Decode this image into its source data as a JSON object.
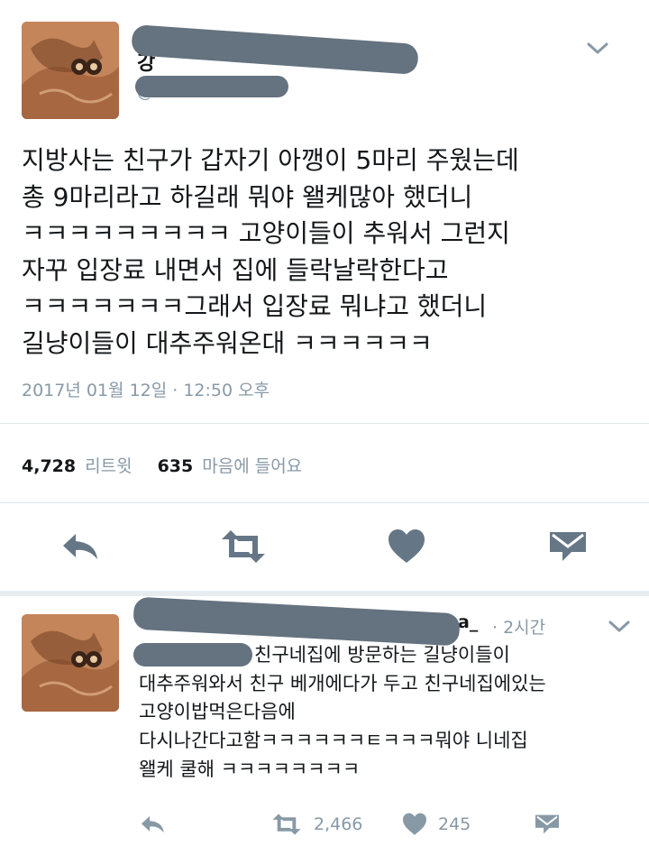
{
  "tweet": {
    "name_visible_head": "강",
    "name_visible_tail": "a",
    "handle_visible_head": "@",
    "text_lines": [
      "지방사는 친구가 갑자기 아깽이 5마리 주웠는데",
      "총 9마리라고 하길래 뭐야 왤케많아 했더니",
      "ㅋㅋㅋㅋㅋㅋㅋㅋㅋ 고양이들이 추워서 그런지",
      "자꾸 입장료 내면서 집에 들락날락한다고",
      "ㅋㅋㅋㅋㅋㅋㅋ그래서 입장료 뭐냐고 했더니",
      "길냥이들이 대추주워온대 ㅋㅋㅋㅋㅋㅋ"
    ],
    "timestamp": "2017년 01월 12일 · 12:50 오후",
    "retweet_count": "4,728",
    "retweet_label": "리트윗",
    "like_count": "635",
    "like_label": "마음에 들어요",
    "icons": [
      "avatar",
      "chevron-down-icon",
      "reply-icon",
      "retweet-icon",
      "like-icon",
      "direct-message-icon"
    ]
  },
  "reply": {
    "name_visible_tail": "a_",
    "time": "· 2시간",
    "text_lines": [
      "친구네집에 방문하는 길냥이들이",
      "대추주워와서 친구 베개에다가 두고 친구네집에있는",
      "고양이밥먹은다음에",
      "다시나간다고함ㅋㅋㅋㅋㅋㅋㅌㅋㅋㅋ뭐야 니네집",
      "왤케 쿨해 ㅋㅋㅋㅋㅋㅋㅋㅋ"
    ],
    "retweet_count": "2,466",
    "like_count": "245"
  },
  "colors": {
    "text": "#14171a",
    "secondary": "#8899a6",
    "icon": "#657786",
    "divider": "#e1e8ed",
    "redaction": "#65727f"
  }
}
